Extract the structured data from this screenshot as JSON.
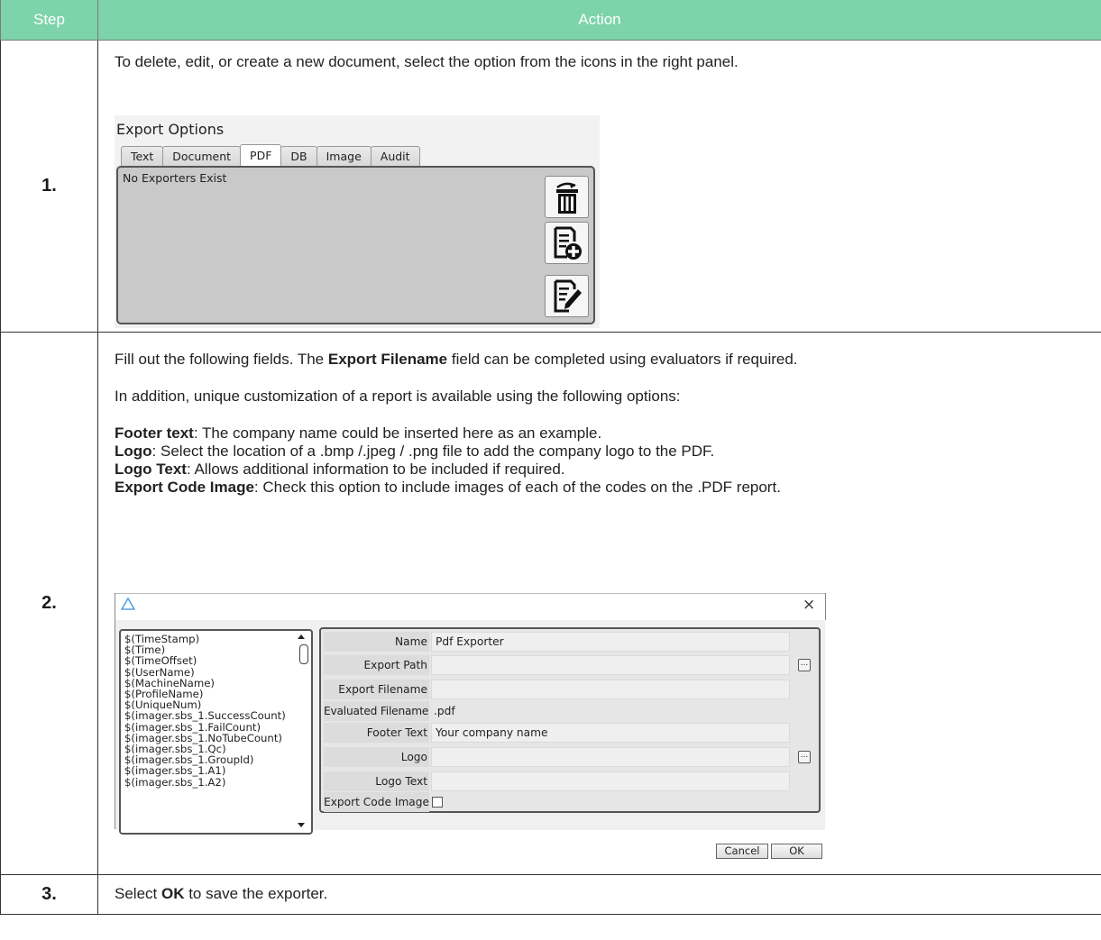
{
  "table": {
    "header_step": "Step",
    "header_action": "Action",
    "colors": {
      "header_bg": "#7dd3aa",
      "header_text": "#ffffff"
    }
  },
  "step1": {
    "number": "1.",
    "text": "To delete, edit, or create a new document, select the option from the icons in the right panel.",
    "export_options": {
      "title": "Export Options",
      "tabs": [
        "Text",
        "Document",
        "PDF",
        "DB",
        "Image",
        "Audit"
      ],
      "active_tab": "PDF",
      "message": "No Exporters Exist",
      "icons": [
        "delete-icon",
        "add-document-icon",
        "edit-document-icon"
      ]
    }
  },
  "step2": {
    "number": "2.",
    "intro_before": "Fill out the following fields. The ",
    "intro_bold": "Export Filename",
    "intro_after": " field can be completed using evaluators if required.",
    "para2": "In addition, unique customization of a report is available using the following options:",
    "options": [
      {
        "term": "Footer text",
        "desc": ": The company name could be inserted here as an example."
      },
      {
        "term": "Logo",
        "desc": ": Select the location of a .bmp /.jpeg / .png file to add the company logo to the PDF."
      },
      {
        "term": "Logo Text",
        "desc": ": Allows additional information to be included if required."
      },
      {
        "term": "Export Code Image",
        "desc": ": Check this option to include images of each of the codes on the .PDF report."
      }
    ],
    "dialog": {
      "close_glyph": "×",
      "evaluators": [
        "$(TimeStamp)",
        "$(Time)",
        "$(TimeOffset)",
        "$(UserName)",
        "$(MachineName)",
        "$(ProfileName)",
        "$(UniqueNum)",
        "$(imager.sbs_1.SuccessCount)",
        "$(imager.sbs_1.FailCount)",
        "$(imager.sbs_1.NoTubeCount)",
        "$(imager.sbs_1.Qc)",
        "$(imager.sbs_1.GroupId)",
        "$(imager.sbs_1.A1)",
        "$(imager.sbs_1.A2)"
      ],
      "fields": {
        "name_label": "Name",
        "name_value": "Pdf Exporter",
        "export_path_label": "Export Path",
        "export_path_value": "",
        "export_filename_label": "Export Filename",
        "export_filename_value": "",
        "evaluated_filename_label": "Evaluated Filename",
        "evaluated_filename_value": ".pdf",
        "footer_text_label": "Footer Text",
        "footer_text_value": "Your company name",
        "logo_label": "Logo",
        "logo_value": "",
        "logo_text_label": "Logo Text",
        "logo_text_value": "",
        "export_code_image_label": "Export Code Image",
        "export_code_image_checked": false
      },
      "browse_glyph": "...",
      "cancel_label": "Cancel",
      "ok_label": "OK"
    }
  },
  "step3": {
    "number": "3.",
    "text_before": "Select ",
    "text_bold": "OK",
    "text_after": " to save the exporter."
  }
}
